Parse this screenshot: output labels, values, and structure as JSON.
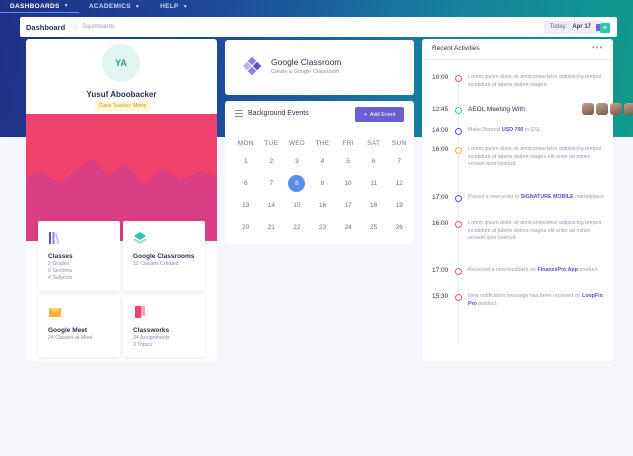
{
  "topnav": [
    {
      "label": "DASHBOARDS",
      "active": true
    },
    {
      "label": "ACADEMICS",
      "active": false
    },
    {
      "label": "HELP",
      "active": false
    }
  ],
  "subbar": {
    "title": "Dashboard",
    "crumb": "Dashboards",
    "date_prefix": "Today:",
    "date": "Apr 17",
    "add": "+"
  },
  "profile": {
    "initials": "YA",
    "name": "Yusuf Aboobacker",
    "role": "Class Teacher: Mimic",
    "chart_colors": {
      "back": "#f0426e",
      "front": "#d93f82"
    }
  },
  "tiles": [
    {
      "title": "Classes",
      "lines": [
        "2 Grades",
        "6 Sections",
        "4 Subjects"
      ],
      "icon": "books-icon"
    },
    {
      "title": "Google Classrooms",
      "lines": [
        "12 Classes Created"
      ],
      "icon": "classroom-icon"
    },
    {
      "title": "Google Meet",
      "lines": [
        "24 Classes at Meet"
      ],
      "icon": "mail-icon"
    },
    {
      "title": "Classworks",
      "lines": [
        "34 Assignments",
        "3 Topics"
      ],
      "icon": "bookmark-icon"
    }
  ],
  "google_classroom": {
    "title": "Google Classroom",
    "subtitle": "Create a Google Classroom"
  },
  "calendar": {
    "title": "Background Events",
    "add_label": "Add Event",
    "days": [
      "MON",
      "TUE",
      "WED",
      "THE",
      "FRI",
      "SAT",
      "SUN"
    ],
    "dates": [
      "1",
      "2",
      "3",
      "4",
      "5",
      "6",
      "7",
      "6",
      "7",
      "8",
      "9",
      "10",
      "11",
      "12",
      "13",
      "14",
      "15",
      "16",
      "17",
      "18",
      "19",
      "20",
      "21",
      "22",
      "23",
      "24",
      "25",
      "26"
    ],
    "selected": "8"
  },
  "recent": {
    "title": "Recent Activities",
    "more": "•••",
    "items": [
      {
        "time": "10:00",
        "color": "#e25b77",
        "text": "Lorem ipsum dolor sit amitconsectetur adipisicing tempor incididunt ut labore dolore magna"
      },
      {
        "time": "12:45",
        "color": "#2ec5a9",
        "heading": "AEOL Meeting With"
      },
      {
        "time": "14:00",
        "color": "#5a4fc9",
        "pre": "Make Deposit",
        "bold": "USD 700",
        "post": "to ESL"
      },
      {
        "time": "16:00",
        "color": "#f3b33d",
        "text": "Lorem ipsum dolor sit amitconsectetur adipisicing tempor incididunt ut labore dolore magna elit enim ad minim veniam quis nostrud"
      },
      {
        "time": "17:00",
        "color": "#5a4fc9",
        "pre": "Placed a new order in",
        "bold": "SIGNATURE MOBILE",
        "post": "marketplace."
      },
      {
        "time": "16:00",
        "color": "#e25b77",
        "text": "Lorem ipsum dolor sit amitconsectetur adipisicing tempor incididunt ut labore dolore magna elit enim ad minim veniam quis nostrud"
      },
      {
        "time": "17:00",
        "color": "#e25b77",
        "pre": "Received a new feedback on",
        "bold": "FinancePro App",
        "post": "product."
      },
      {
        "time": "15:30",
        "color": "#e25b77",
        "pre": "New notification message has been received on",
        "bold": "LoopFin Pro",
        "post": "product."
      }
    ]
  }
}
